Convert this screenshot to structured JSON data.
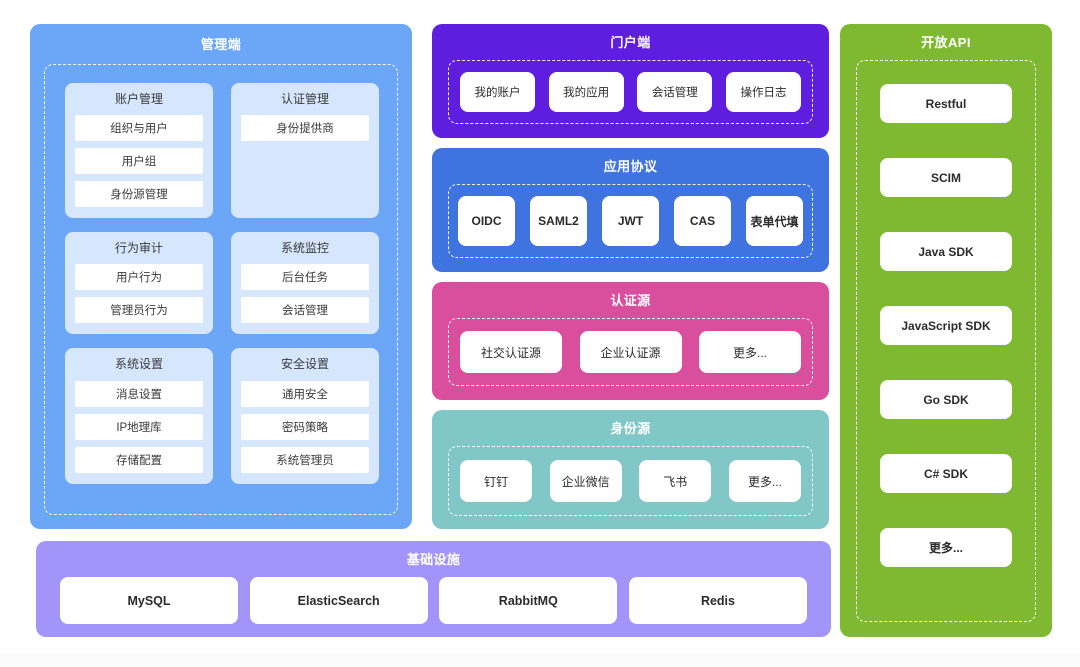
{
  "colors": {
    "management": "#6ca6f7",
    "management_card": "#d6e6fc",
    "portal": "#5f1de0",
    "protocol": "#3e73e0",
    "auth_source": "#d94f9e",
    "identity_source": "#81c7c7",
    "open_api": "#7fb932",
    "infrastructure": "#a394f9",
    "chip": "#ffffff",
    "canvas": "#ffffff"
  },
  "management": {
    "title": "管理端",
    "cards": [
      {
        "title": "账户管理",
        "items": [
          "组织与用户",
          "用户组",
          "身份源管理"
        ]
      },
      {
        "title": "认证管理",
        "items": [
          "身份提供商"
        ]
      },
      {
        "title": "行为审计",
        "items": [
          "用户行为",
          "管理员行为"
        ]
      },
      {
        "title": "系统监控",
        "items": [
          "后台任务",
          "会话管理"
        ]
      },
      {
        "title": "系统设置",
        "items": [
          "消息设置",
          "IP地理库",
          "存储配置"
        ]
      },
      {
        "title": "安全设置",
        "items": [
          "通用安全",
          "密码策略",
          "系统管理员"
        ]
      }
    ]
  },
  "portal": {
    "title": "门户端",
    "items": [
      "我的账户",
      "我的应用",
      "会话管理",
      "操作日志"
    ]
  },
  "protocol": {
    "title": "应用协议",
    "items": [
      "OIDC",
      "SAML2",
      "JWT",
      "CAS",
      "表单代填"
    ]
  },
  "auth_source": {
    "title": "认证源",
    "items": [
      "社交认证源",
      "企业认证源",
      "更多..."
    ]
  },
  "identity_source": {
    "title": "身份源",
    "items": [
      "钉钉",
      "企业微信",
      "飞书",
      "更多..."
    ]
  },
  "open_api": {
    "title": "开放API",
    "items": [
      "Restful",
      "SCIM",
      "Java SDK",
      "JavaScript SDK",
      "Go SDK",
      "C# SDK",
      "更多..."
    ]
  },
  "infrastructure": {
    "title": "基础设施",
    "items": [
      "MySQL",
      "ElasticSearch",
      "RabbitMQ",
      "Redis"
    ]
  }
}
